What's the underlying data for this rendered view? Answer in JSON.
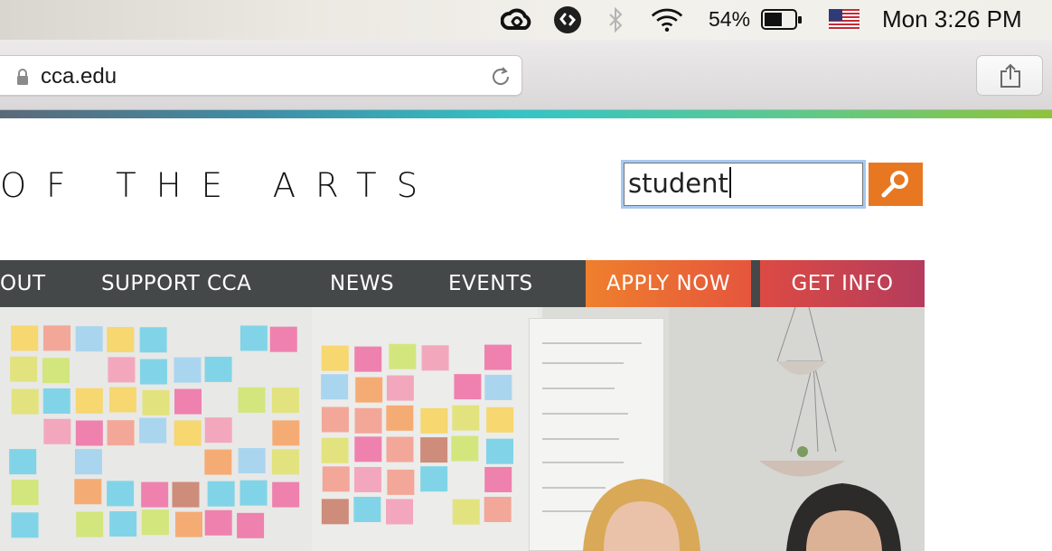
{
  "menubar": {
    "icons": [
      "creative-cloud-icon",
      "shazam-icon",
      "bluetooth-icon",
      "wifi-icon",
      "battery-icon",
      "us-flag-icon"
    ],
    "battery_percent": "54%",
    "clock": "Mon 3:26 PM"
  },
  "browser": {
    "url": "cca.edu"
  },
  "site": {
    "logo_text": "OF THE ARTS",
    "search": {
      "value": "student"
    },
    "nav": {
      "items": [
        "OUT",
        "SUPPORT CCA",
        "NEWS",
        "EVENTS"
      ],
      "apply": "APPLY NOW",
      "info": "GET INFO"
    }
  },
  "colors": {
    "accent_orange": "#e87722",
    "nav_bg": "#454849",
    "apply_bg": "#ef7f2d",
    "info_bg": "#dc4a43",
    "focus_ring": "#a7c8ef"
  }
}
